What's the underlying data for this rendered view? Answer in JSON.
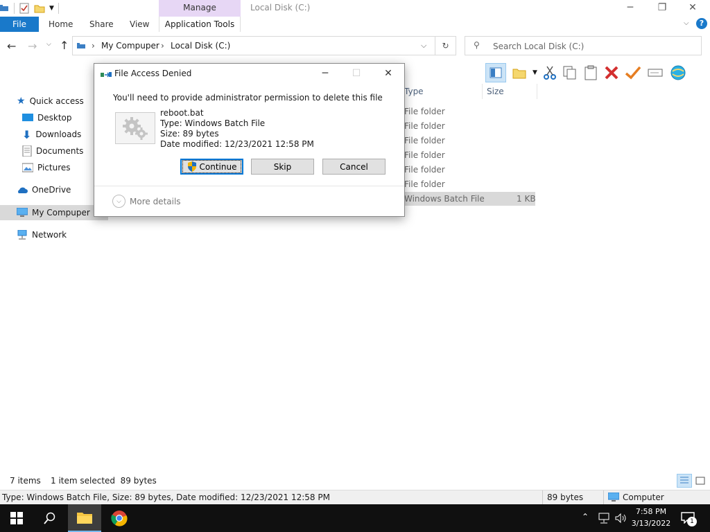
{
  "window": {
    "title": "Local Disk (C:)",
    "manage_tab": "Manage",
    "minimize": "─",
    "maximize": "❐",
    "close": "✕"
  },
  "ribbon": {
    "file": "File",
    "home": "Home",
    "share": "Share",
    "view": "View",
    "app_tools": "Application Tools"
  },
  "address": {
    "crumbs": [
      "My Compuper",
      "Local Disk (C:)"
    ],
    "search_placeholder": "Search Local Disk (C:)"
  },
  "nav": {
    "items": [
      {
        "label": "Quick access"
      },
      {
        "label": "Desktop"
      },
      {
        "label": "Downloads"
      },
      {
        "label": "Documents"
      },
      {
        "label": "Pictures"
      },
      {
        "label": "OneDrive"
      },
      {
        "label": "My Compuper"
      },
      {
        "label": "Network"
      }
    ]
  },
  "columns": {
    "type": "Type",
    "size": "Size"
  },
  "rows": [
    {
      "type": "File folder",
      "size": ""
    },
    {
      "type": "File folder",
      "size": ""
    },
    {
      "type": "File folder",
      "size": ""
    },
    {
      "type": "File folder",
      "size": ""
    },
    {
      "type": "File folder",
      "size": ""
    },
    {
      "type": "File folder",
      "size": ""
    },
    {
      "type": "Windows Batch File",
      "size": "1 KB"
    }
  ],
  "status": {
    "items": "7 items",
    "selected": "1 item selected  89 bytes",
    "details": "Type: Windows Batch File, Size: 89 bytes, Date modified: 12/23/2021 12:58 PM",
    "size": "89 bytes",
    "location": "Computer"
  },
  "dialog": {
    "title": "File Access Denied",
    "message": "You'll need to provide administrator permission to delete this file",
    "file_name": "reboot.bat",
    "file_type": "Type: Windows Batch File",
    "file_size": "Size: 89 bytes",
    "file_date": "Date modified: 12/23/2021 12:58 PM",
    "continue": "Continue",
    "skip": "Skip",
    "cancel": "Cancel",
    "more_details": "More details"
  },
  "taskbar": {
    "time": "7:58 PM",
    "date": "3/13/2022",
    "notif_count": "1"
  }
}
